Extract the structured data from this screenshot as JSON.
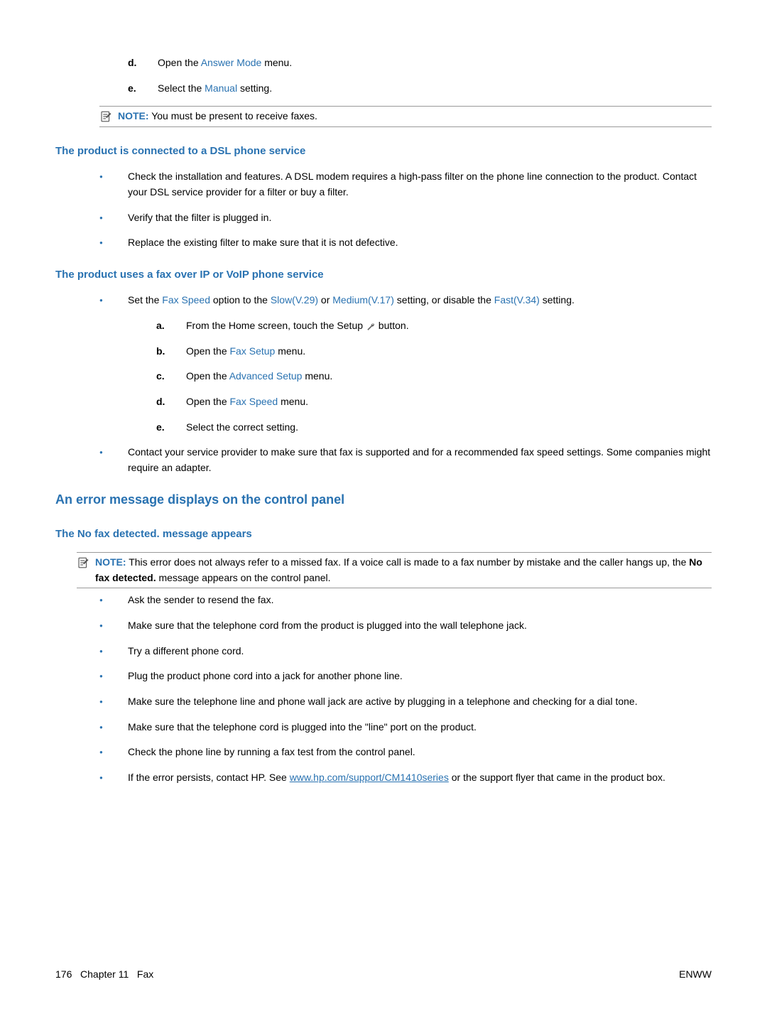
{
  "sub_d": {
    "marker": "d.",
    "pre": "Open the ",
    "link": "Answer Mode",
    "post": " menu."
  },
  "sub_e": {
    "marker": "e.",
    "pre": "Select the ",
    "link": "Manual",
    "post": " setting."
  },
  "note1": {
    "label": "NOTE:",
    "text": "You must be present to receive faxes."
  },
  "h_dsl": "The product is connected to a DSL phone service",
  "dsl_b1": "Check the installation and features. A DSL modem requires a high-pass filter on the phone line connection to the product. Contact your DSL service provider for a filter or buy a filter.",
  "dsl_b2": "Verify that the filter is plugged in.",
  "dsl_b3": "Replace the existing filter to make sure that it is not defective.",
  "h_voip": "The product uses a fax over IP or VoIP phone service",
  "voip_b1": {
    "pre": "Set the ",
    "l1": "Fax Speed",
    "mid1": " option to the ",
    "l2": "Slow(V.29)",
    "mid2": " or ",
    "l3": "Medium(V.17)",
    "mid3": " setting, or disable the ",
    "l4": "Fast(V.34)",
    "post": " setting."
  },
  "voip_a": {
    "marker": "a.",
    "pre": "From the Home screen, touch the Setup ",
    "post": " button."
  },
  "voip_b": {
    "marker": "b.",
    "pre": "Open the ",
    "link": "Fax Setup",
    "post": " menu."
  },
  "voip_c": {
    "marker": "c.",
    "pre": "Open the ",
    "link": "Advanced Setup",
    "post": " menu."
  },
  "voip_d": {
    "marker": "d.",
    "pre": "Open the ",
    "link": "Fax Speed",
    "post": " menu."
  },
  "voip_e": {
    "marker": "e.",
    "text": "Select the correct setting."
  },
  "voip_b2": "Contact your service provider to make sure that fax is supported and for a recommended fax speed settings. Some companies might require an adapter.",
  "h_err": "An error message displays on the control panel",
  "h_nofax": "The No fax detected. message appears",
  "note2": {
    "label": "NOTE:",
    "pre": "This error does not always refer to a missed fax. If a voice call is made to a fax number by mistake and the caller hangs up, the ",
    "bold": "No fax detected.",
    "post": " message appears on the control panel."
  },
  "nf_b1": "Ask the sender to resend the fax.",
  "nf_b2": "Make sure that the telephone cord from the product is plugged into the wall telephone jack.",
  "nf_b3": "Try a different phone cord.",
  "nf_b4": "Plug the product phone cord into a jack for another phone line.",
  "nf_b5": "Make sure the telephone line and phone wall jack are active by plugging in a telephone and checking for a dial tone.",
  "nf_b6": "Make sure that the telephone cord is plugged into the \"line\" port on the product.",
  "nf_b7": "Check the phone line by running a fax test from the control panel.",
  "nf_b8": {
    "pre": "If the error persists, contact HP. See ",
    "link": "www.hp.com/support/CM1410series",
    "post": " or the support flyer that came in the product box."
  },
  "footer": {
    "left_page": "176",
    "left_chapter": "Chapter 11   Fax",
    "right": "ENWW"
  }
}
